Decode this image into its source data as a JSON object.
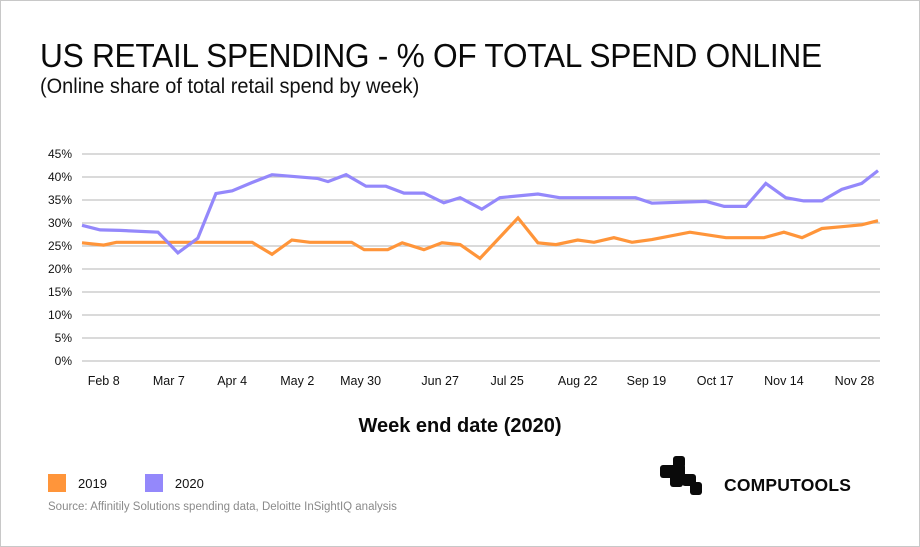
{
  "header": {
    "title": "US RETAIL SPENDING - % OF TOTAL SPEND ONLINE",
    "subtitle": "(Online share of total retail spend by week)"
  },
  "chart_data": {
    "type": "line",
    "title": "US RETAIL SPENDING - % OF TOTAL SPEND ONLINE",
    "subtitle": "(Online share of total retail spend by week)",
    "xlabel": "Week end date (2020)",
    "ylabel": "",
    "x_unit": "week index (0 = first week shown, weekly steps)",
    "xlim": [
      0,
      44
    ],
    "ylim": [
      0,
      45
    ],
    "yticks": [
      0,
      5,
      10,
      15,
      20,
      25,
      30,
      35,
      40,
      45
    ],
    "ytick_labels": [
      "0%",
      "5%",
      "10%",
      "15%",
      "20%",
      "25%",
      "30%",
      "35%",
      "40%",
      "45%"
    ],
    "xticks": [
      {
        "x": 1.2,
        "label": "Feb 8"
      },
      {
        "x": 4.8,
        "label": "Mar 7"
      },
      {
        "x": 8.3,
        "label": "Apr 4"
      },
      {
        "x": 11.9,
        "label": "May 2"
      },
      {
        "x": 15.4,
        "label": "May 30"
      },
      {
        "x": 19.8,
        "label": "Jun 27"
      },
      {
        "x": 23.5,
        "label": "Jul 25"
      },
      {
        "x": 27.4,
        "label": "Aug 22"
      },
      {
        "x": 31.2,
        "label": "Sep 19"
      },
      {
        "x": 35.0,
        "label": "Oct 17"
      },
      {
        "x": 38.8,
        "label": "Nov 14"
      },
      {
        "x": 42.7,
        "label": "Nov 28"
      }
    ],
    "grid": true,
    "legend_position": "bottom-left",
    "series": [
      {
        "name": "2019",
        "color": "#ff953a",
        "points": [
          [
            0.0,
            25.7
          ],
          [
            1.2,
            25.2
          ],
          [
            1.9,
            25.8
          ],
          [
            9.4,
            25.8
          ],
          [
            10.5,
            23.2
          ],
          [
            11.6,
            26.3
          ],
          [
            12.6,
            25.8
          ],
          [
            14.9,
            25.8
          ],
          [
            15.6,
            24.2
          ],
          [
            16.9,
            24.2
          ],
          [
            17.7,
            25.7
          ],
          [
            18.9,
            24.2
          ],
          [
            19.9,
            25.7
          ],
          [
            20.9,
            25.3
          ],
          [
            22.0,
            22.3
          ],
          [
            24.1,
            31.1
          ],
          [
            25.2,
            25.7
          ],
          [
            26.2,
            25.3
          ],
          [
            27.4,
            26.3
          ],
          [
            28.3,
            25.8
          ],
          [
            29.4,
            26.8
          ],
          [
            30.4,
            25.8
          ],
          [
            31.5,
            26.4
          ],
          [
            33.6,
            28.0
          ],
          [
            35.6,
            26.8
          ],
          [
            37.7,
            26.8
          ],
          [
            38.8,
            28.0
          ],
          [
            39.8,
            26.8
          ],
          [
            40.9,
            28.8
          ],
          [
            42.0,
            29.2
          ],
          [
            43.1,
            29.6
          ],
          [
            44.0,
            30.5
          ]
        ]
      },
      {
        "name": "2020",
        "color": "#9488fb",
        "points": [
          [
            0.0,
            29.5
          ],
          [
            1.0,
            28.5
          ],
          [
            2.1,
            28.4
          ],
          [
            4.2,
            28.0
          ],
          [
            5.3,
            23.5
          ],
          [
            6.4,
            26.7
          ],
          [
            7.4,
            36.4
          ],
          [
            8.3,
            37.0
          ],
          [
            9.4,
            38.8
          ],
          [
            10.5,
            40.5
          ],
          [
            13.0,
            39.7
          ],
          [
            13.6,
            39.0
          ],
          [
            14.6,
            40.5
          ],
          [
            15.7,
            38.0
          ],
          [
            16.8,
            38.0
          ],
          [
            17.8,
            36.5
          ],
          [
            18.9,
            36.5
          ],
          [
            20.0,
            34.4
          ],
          [
            20.9,
            35.5
          ],
          [
            22.1,
            33.0
          ],
          [
            23.1,
            35.5
          ],
          [
            25.2,
            36.3
          ],
          [
            26.4,
            35.5
          ],
          [
            30.6,
            35.5
          ],
          [
            31.5,
            34.3
          ],
          [
            34.5,
            34.7
          ],
          [
            35.5,
            33.6
          ],
          [
            36.7,
            33.6
          ],
          [
            37.8,
            38.6
          ],
          [
            38.9,
            35.5
          ],
          [
            39.9,
            34.8
          ],
          [
            40.9,
            34.8
          ],
          [
            42.0,
            37.3
          ],
          [
            43.1,
            38.6
          ],
          [
            44.0,
            41.4
          ]
        ]
      }
    ]
  },
  "legend": {
    "items": [
      {
        "label": "2019",
        "color": "#ff953a"
      },
      {
        "label": "2020",
        "color": "#9488fb"
      }
    ]
  },
  "footer": {
    "source": "Source: Affinitily Solutions spending data, Deloitte InSightIQ analysis",
    "brand": "COMPUTOOLS"
  }
}
